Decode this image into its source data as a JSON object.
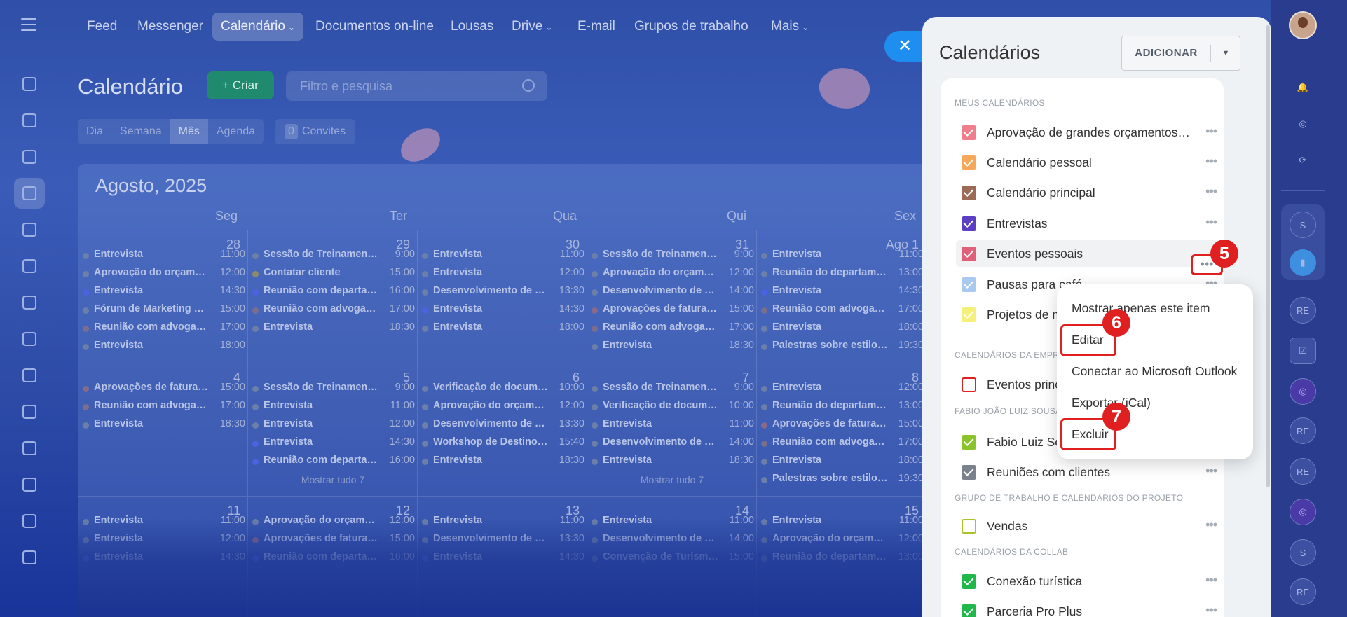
{
  "nav": {
    "items": [
      {
        "label": "Feed"
      },
      {
        "label": "Messenger"
      },
      {
        "label": "Calendário",
        "chevron": true,
        "active": true
      },
      {
        "label": "Documentos on-line"
      },
      {
        "label": "Lousas"
      },
      {
        "label": "Drive",
        "chevron": true
      },
      {
        "label": "E-mail"
      },
      {
        "label": "Grupos de trabalho"
      },
      {
        "label": "Mais",
        "chevron": true
      }
    ]
  },
  "page": {
    "title": "Calendário",
    "create_label": "+ Criar",
    "filter_placeholder": "Filtro e pesquisa",
    "view_tabs": [
      "Dia",
      "Semana",
      "Mês",
      "Agenda"
    ],
    "invites_count": "0",
    "invites_label": "Convites",
    "month_label": "Agosto, 2025",
    "day_names": [
      "Seg",
      "Ter",
      "Qua",
      "Qui",
      "Sex"
    ]
  },
  "calendar_weeks": [
    {
      "days": [
        {
          "num": "28",
          "events": [
            {
              "t": "Entrevista",
              "h": "11:00",
              "c": "#6b7fa8"
            },
            {
              "t": "Aprovação do orçament...",
              "h": "12:00",
              "c": "#6b7fa8"
            },
            {
              "t": "Entrevista",
              "h": "14:30",
              "c": "#4b63e0"
            },
            {
              "t": "Fórum de Marketing Di...",
              "h": "15:00",
              "c": "#6b7fa8"
            },
            {
              "t": "Reunião com advogados",
              "h": "17:00",
              "c": "#7a6e8c"
            },
            {
              "t": "Entrevista",
              "h": "18:00",
              "c": "#6b7fa8"
            }
          ]
        },
        {
          "num": "29",
          "events": [
            {
              "t": "Sessão de Treinamento d...",
              "h": "9:00",
              "c": "#6b7fa8"
            },
            {
              "t": "Contatar cliente",
              "h": "15:00",
              "c": "#8c8a6a"
            },
            {
              "t": "Reunião com departam...",
              "h": "16:00",
              "c": "#4b63e0"
            },
            {
              "t": "Reunião com advogados",
              "h": "17:00",
              "c": "#7a6e8c"
            },
            {
              "t": "Entrevista",
              "h": "18:30",
              "c": "#6b7fa8"
            }
          ]
        },
        {
          "num": "30",
          "events": [
            {
              "t": "Entrevista",
              "h": "11:00",
              "c": "#6b7fa8"
            },
            {
              "t": "Entrevista",
              "h": "12:00",
              "c": "#6b7fa8"
            },
            {
              "t": "Desenvolvimento de do...",
              "h": "13:30",
              "c": "#6b7fa8"
            },
            {
              "t": "Entrevista",
              "h": "14:30",
              "c": "#4b63e0"
            },
            {
              "t": "Entrevista",
              "h": "18:00",
              "c": "#6b7fa8"
            }
          ]
        },
        {
          "num": "31",
          "events": [
            {
              "t": "Sessão de Treinamento d...",
              "h": "9:00",
              "c": "#6b7fa8"
            },
            {
              "t": "Aprovação do orçament...",
              "h": "12:00",
              "c": "#6b7fa8"
            },
            {
              "t": "Desenvolvimento de reg...",
              "h": "14:00",
              "c": "#6b7fa8"
            },
            {
              "t": "Aprovações de faturas d...",
              "h": "15:00",
              "c": "#8a6a88"
            },
            {
              "t": "Reunião com advogados",
              "h": "17:00",
              "c": "#7a6e8c"
            },
            {
              "t": "Entrevista",
              "h": "18:30",
              "c": "#6b7fa8"
            }
          ]
        },
        {
          "num": "Ago 1",
          "events": [
            {
              "t": "Entrevista",
              "h": "11:00",
              "c": "#6b7fa8"
            },
            {
              "t": "Reunião do departamen...",
              "h": "13:00",
              "c": "#6b7fa8"
            },
            {
              "t": "Entrevista",
              "h": "14:30",
              "c": "#4b63e0"
            },
            {
              "t": "Reunião com advogados",
              "h": "17:00",
              "c": "#7a6e8c"
            },
            {
              "t": "Entrevista",
              "h": "18:00",
              "c": "#6b7fa8"
            },
            {
              "t": "Palestras sobre estilo de...",
              "h": "19:30",
              "c": "#6b7fa8"
            }
          ]
        }
      ]
    },
    {
      "days": [
        {
          "num": "4",
          "events": [
            {
              "t": "Aprovações de faturas d...",
              "h": "15:00",
              "c": "#8a6a88"
            },
            {
              "t": "Reunião com advogados",
              "h": "17:00",
              "c": "#7a6e8c"
            },
            {
              "t": "Entrevista",
              "h": "18:30",
              "c": "#6b7fa8"
            }
          ]
        },
        {
          "num": "5",
          "events": [
            {
              "t": "Sessão de Treinamento d...",
              "h": "9:00",
              "c": "#6b7fa8"
            },
            {
              "t": "Entrevista",
              "h": "11:00",
              "c": "#6b7fa8"
            },
            {
              "t": "Entrevista",
              "h": "12:00",
              "c": "#6b7fa8"
            },
            {
              "t": "Entrevista",
              "h": "14:30",
              "c": "#4b63e0"
            },
            {
              "t": "Reunião com departam...",
              "h": "16:00",
              "c": "#4b63e0"
            }
          ],
          "more": "Mostrar tudo 7"
        },
        {
          "num": "6",
          "events": [
            {
              "t": "Verificação de documen...",
              "h": "10:00",
              "c": "#6b7fa8"
            },
            {
              "t": "Aprovação do orçament...",
              "h": "12:00",
              "c": "#6b7fa8"
            },
            {
              "t": "Desenvolvimento de do...",
              "h": "13:30",
              "c": "#6b7fa8"
            },
            {
              "t": "Workshop de Destinos E...",
              "h": "15:40",
              "c": "#6b7fa8"
            },
            {
              "t": "Entrevista",
              "h": "18:30",
              "c": "#6b7fa8"
            }
          ]
        },
        {
          "num": "7",
          "events": [
            {
              "t": "Sessão de Treinamento d...",
              "h": "9:00",
              "c": "#6b7fa8"
            },
            {
              "t": "Verificação de documen...",
              "h": "10:00",
              "c": "#6b7fa8"
            },
            {
              "t": "Entrevista",
              "h": "11:00",
              "c": "#6b7fa8"
            },
            {
              "t": "Desenvolvimento de reg...",
              "h": "14:00",
              "c": "#6b7fa8"
            },
            {
              "t": "Entrevista",
              "h": "18:30",
              "c": "#6b7fa8"
            }
          ],
          "more": "Mostrar tudo 7"
        },
        {
          "num": "8",
          "events": [
            {
              "t": "Entrevista",
              "h": "12:00",
              "c": "#6b7fa8"
            },
            {
              "t": "Reunião do departamen...",
              "h": "13:00",
              "c": "#6b7fa8"
            },
            {
              "t": "Aprovações de faturas d...",
              "h": "15:00",
              "c": "#8a6a88"
            },
            {
              "t": "Reunião com advogados",
              "h": "17:00",
              "c": "#7a6e8c"
            },
            {
              "t": "Entrevista",
              "h": "18:00",
              "c": "#6b7fa8"
            },
            {
              "t": "Palestras sobre estilo de...",
              "h": "19:30",
              "c": "#6b7fa8"
            }
          ]
        }
      ]
    },
    {
      "days": [
        {
          "num": "11",
          "events": [
            {
              "t": "Entrevista",
              "h": "11:00",
              "c": "#6b7fa8"
            },
            {
              "t": "Entrevista",
              "h": "12:00",
              "c": "#6b7fa8"
            },
            {
              "t": "Entrevista",
              "h": "14:30",
              "c": "#4b63e0"
            }
          ]
        },
        {
          "num": "12",
          "events": [
            {
              "t": "Aprovação do orçament...",
              "h": "12:00",
              "c": "#6b7fa8"
            },
            {
              "t": "Aprovações de faturas d...",
              "h": "15:00",
              "c": "#8a6a88"
            },
            {
              "t": "Reunião com departam...",
              "h": "16:00",
              "c": "#4b63e0"
            }
          ]
        },
        {
          "num": "13",
          "events": [
            {
              "t": "Entrevista",
              "h": "11:00",
              "c": "#6b7fa8"
            },
            {
              "t": "Desenvolvimento de do...",
              "h": "13:30",
              "c": "#6b7fa8"
            },
            {
              "t": "Entrevista",
              "h": "14:30",
              "c": "#4b63e0"
            }
          ]
        },
        {
          "num": "14",
          "events": [
            {
              "t": "Entrevista",
              "h": "11:00",
              "c": "#6b7fa8"
            },
            {
              "t": "Desenvolvimento de reg...",
              "h": "14:00",
              "c": "#6b7fa8"
            },
            {
              "t": "Convenção de Turismo...",
              "h": "15:00",
              "c": "#6b7fa8"
            }
          ]
        },
        {
          "num": "15",
          "events": [
            {
              "t": "Entrevista",
              "h": "11:00",
              "c": "#6b7fa8"
            },
            {
              "t": "Aprovação do orçament...",
              "h": "12:00",
              "c": "#6b7fa8"
            },
            {
              "t": "Reunião do departamen...",
              "h": "13:00",
              "c": "#6b7fa8"
            }
          ]
        }
      ]
    }
  ],
  "panel": {
    "title": "Calendários",
    "add_label": "ADICIONAR",
    "sections": [
      {
        "heading": "MEUS CALENDÁRIOS",
        "rows": [
          {
            "label": "Aprovação de grandes orçamentos ...",
            "color": "#f07d8c",
            "checked": true
          },
          {
            "label": "Calendário pessoal",
            "color": "#f5a85a",
            "checked": true
          },
          {
            "label": "Calendário principal",
            "color": "#9c6a55",
            "checked": true
          },
          {
            "label": "Entrevistas",
            "color": "#5c3fc4",
            "checked": true
          },
          {
            "label": "Eventos pessoais",
            "color": "#e0607a",
            "checked": true,
            "highlighted": true
          },
          {
            "label": "Pausas para café",
            "color": "#a8c9f0",
            "checked": true
          },
          {
            "label": "Projetos de marketing",
            "color": "#f5f07a",
            "checked": true
          }
        ]
      },
      {
        "heading": "CALENDÁRIOS DA EMPRESA",
        "rows": [
          {
            "label": "Eventos principais",
            "color": "#e02020",
            "checked": false
          }
        ]
      },
      {
        "heading": "FABIO JOÃO LUIZ SOUSA",
        "rows": [
          {
            "label": "Fabio Luiz Sousa",
            "color": "#8ac42a",
            "checked": true
          },
          {
            "label": "Reuniões com clientes",
            "color": "#7c828c",
            "checked": true
          }
        ]
      },
      {
        "heading": "GRUPO DE TRABALHO E CALENDÁRIOS DO PROJETO",
        "rows": [
          {
            "label": "Vendas",
            "color": "#a8c22a",
            "checked": false
          }
        ]
      },
      {
        "heading": "CALENDÁRIOS DA COLLAB",
        "rows": [
          {
            "label": "Conexão turística",
            "color": "#1fb84a",
            "checked": true
          },
          {
            "label": "Parceria Pro Plus",
            "color": "#1fb84a",
            "checked": true
          }
        ]
      }
    ]
  },
  "context_menu": {
    "items": [
      "Mostrar apenas este item",
      "Editar",
      "Conectar ao Microsoft Outlook",
      "Exportar (iCal)",
      "Excluir"
    ]
  },
  "callouts": {
    "step5": "5",
    "step6": "6",
    "step7": "7"
  },
  "right_rail": {
    "items": [
      "S",
      "RE",
      "RE",
      "RE",
      "S",
      "RE"
    ]
  },
  "icons": {
    "close": "close-icon",
    "more": "more-dots-icon",
    "search": "search-icon"
  }
}
